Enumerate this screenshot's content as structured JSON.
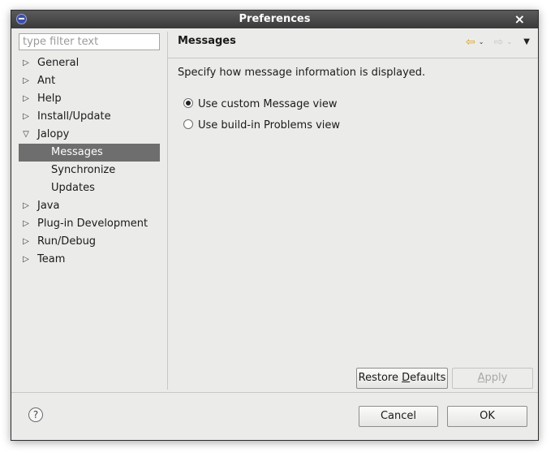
{
  "window": {
    "title": "Preferences",
    "close_glyph": "×",
    "app_icon": "eclipse-icon"
  },
  "filter": {
    "placeholder": "type filter text",
    "value": ""
  },
  "tree": {
    "items": [
      {
        "label": "General",
        "arrow": "▷"
      },
      {
        "label": "Ant",
        "arrow": "▷"
      },
      {
        "label": "Help",
        "arrow": "▷"
      },
      {
        "label": "Install/Update",
        "arrow": "▷"
      },
      {
        "label": "Jalopy",
        "arrow": "▽"
      },
      {
        "label": "Messages",
        "selected": true
      },
      {
        "label": "Synchronize"
      },
      {
        "label": "Updates"
      },
      {
        "label": "Java",
        "arrow": "▷"
      },
      {
        "label": "Plug-in Development",
        "arrow": "▷"
      },
      {
        "label": "Run/Debug",
        "arrow": "▷"
      },
      {
        "label": "Team",
        "arrow": "▷"
      }
    ]
  },
  "page": {
    "title": "Messages",
    "description": "Specify how message information is displayed.",
    "options": [
      {
        "label": "Use custom Message view",
        "checked": true
      },
      {
        "label": "Use build-in Problems view",
        "checked": false
      }
    ],
    "nav": {
      "back_glyph": "⇦",
      "forward_glyph": "⇨",
      "caret_glyph": "⌄",
      "menu_glyph": "▼"
    }
  },
  "buttons": {
    "restore_defaults": {
      "pre": "Restore ",
      "mnemonic": "D",
      "post": "efaults"
    },
    "apply": {
      "pre": "",
      "mnemonic": "A",
      "post": "pply",
      "enabled": false
    },
    "cancel": "Cancel",
    "ok": "OK",
    "help_glyph": "?"
  },
  "colors": {
    "selection": "#6e6e6e",
    "titlebar": "#4a4a4a",
    "back_arrow": "#d7a31c"
  }
}
